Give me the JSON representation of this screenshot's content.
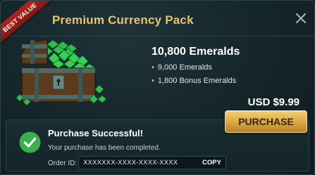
{
  "dialog": {
    "title": "Premium Currency Pack",
    "badge": "BEST VALUE",
    "close_icon": "close-icon"
  },
  "product": {
    "image_icon": "treasure-chest-icon",
    "amount": "10,800 Emeralds",
    "bullets": [
      "9,000 Emeralds",
      "1,800 Bonus Emeralds"
    ],
    "price": "USD $9.99",
    "purchase_label": "PURCHASE"
  },
  "success": {
    "icon": "checkmark-icon",
    "title": "Purchase Successful!",
    "description": "Your purchase has been completed.",
    "order_label": "Order ID:",
    "order_id": "XXXXXXX-XXXX-XXXX-XXXX",
    "copy_label": "COPY"
  },
  "colors": {
    "accent_gold": "#e8c56a",
    "badge_red": "#b3261e",
    "success_green": "#3bb14b",
    "emerald": "#2fbf4a",
    "background": "#14252a"
  }
}
